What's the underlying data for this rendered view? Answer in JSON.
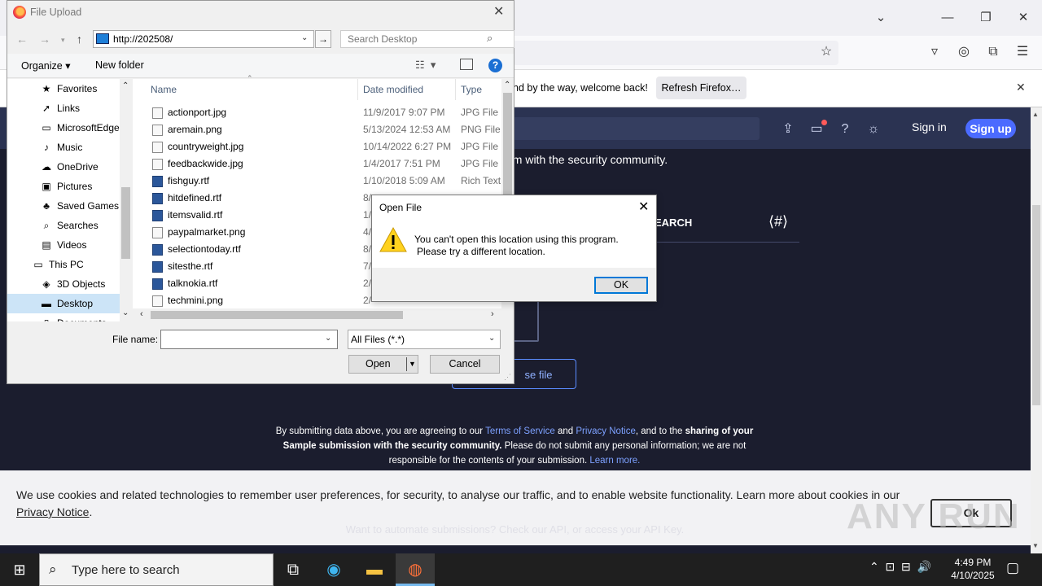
{
  "browser": {
    "notification_text": "nd by the way, welcome back!",
    "refresh_label": "Refresh Firefox…"
  },
  "site": {
    "signin_label": "Sign in",
    "signup_label": "Sign up",
    "tagline": "em with the security community.",
    "search_tab_label": "EARCH",
    "choose_file_label": "se file",
    "terms_parts": {
      "p1": "By submitting data above, you are agreeing to our ",
      "tos": "Terms of Service",
      "and": " and ",
      "privacy": "Privacy Notice",
      "p2": ", and to the ",
      "bold1": "sharing of your Sample submission with the security community.",
      "p3": " Please do not submit any personal information; we are not responsible for the contents of your submission. ",
      "learn": "Learn more."
    },
    "cookie_text": "We use cookies and related technologies to remember user preferences, for security, to analyse our traffic, and to enable website functionality. Learn more about cookies in our ",
    "cookie_link": "Privacy Notice",
    "cookie_end": ".",
    "cookie_ok": "Ok",
    "automate_text": "Want to automate submissions? Check our API, or access your API Key.",
    "watermark": "ANY RUN"
  },
  "file_upload": {
    "title": "File Upload",
    "address": "http://202508/",
    "search_placeholder": "Search Desktop",
    "organize_label": "Organize ▾",
    "new_folder_label": "New folder",
    "columns": {
      "name": "Name",
      "date": "Date modified",
      "type": "Type"
    },
    "tree": [
      {
        "label": "Favorites",
        "icon": "★",
        "indent": 1
      },
      {
        "label": "Links",
        "icon": "➚",
        "indent": 1
      },
      {
        "label": "MicrosoftEdge",
        "icon": "▭",
        "indent": 1
      },
      {
        "label": "Music",
        "icon": "♪",
        "indent": 1
      },
      {
        "label": "OneDrive",
        "icon": "☁",
        "indent": 1
      },
      {
        "label": "Pictures",
        "icon": "▣",
        "indent": 1
      },
      {
        "label": "Saved Games",
        "icon": "♣",
        "indent": 1
      },
      {
        "label": "Searches",
        "icon": "⌕",
        "indent": 1
      },
      {
        "label": "Videos",
        "icon": "▤",
        "indent": 1
      },
      {
        "label": "This PC",
        "icon": "▭",
        "indent": 0
      },
      {
        "label": "3D Objects",
        "icon": "◈",
        "indent": 1
      },
      {
        "label": "Desktop",
        "icon": "▬",
        "indent": 1
      },
      {
        "label": "Documents",
        "icon": "▯",
        "indent": 1
      }
    ],
    "files": [
      {
        "name": "actionport.jpg",
        "date": "11/9/2017 9:07 PM",
        "type": "JPG File",
        "rtf": false
      },
      {
        "name": "aremain.png",
        "date": "5/13/2024 12:53 AM",
        "type": "PNG File",
        "rtf": false
      },
      {
        "name": "countryweight.jpg",
        "date": "10/14/2022 6:27 PM",
        "type": "JPG File",
        "rtf": false
      },
      {
        "name": "feedbackwide.jpg",
        "date": "1/4/2017 7:51 PM",
        "type": "JPG File",
        "rtf": false
      },
      {
        "name": "fishguy.rtf",
        "date": "1/10/2018 5:09 AM",
        "type": "Rich Text",
        "rtf": true
      },
      {
        "name": "hitdefined.rtf",
        "date": "8/",
        "type": "",
        "rtf": true
      },
      {
        "name": "itemsvalid.rtf",
        "date": "1/",
        "type": "",
        "rtf": true
      },
      {
        "name": "paypalmarket.png",
        "date": "4/",
        "type": "",
        "rtf": false
      },
      {
        "name": "selectiontoday.rtf",
        "date": "8/",
        "type": "",
        "rtf": true
      },
      {
        "name": "sitesthe.rtf",
        "date": "7/",
        "type": "",
        "rtf": true
      },
      {
        "name": "talknokia.rtf",
        "date": "2/",
        "type": "",
        "rtf": true
      },
      {
        "name": "techmini.png",
        "date": "2/",
        "type": "",
        "rtf": false
      }
    ],
    "filename_label": "File name:",
    "filename_value": "",
    "filter_label": "All Files (*.*)",
    "open_label": "Open",
    "cancel_label": "Cancel"
  },
  "message_box": {
    "title": "Open File",
    "line1": "You can't open this location using this program.",
    "line2": "Please try a different location.",
    "ok_label": "OK"
  },
  "taskbar": {
    "search_placeholder": "Type here to search",
    "time": "4:49 PM",
    "date": "4/10/2025"
  }
}
